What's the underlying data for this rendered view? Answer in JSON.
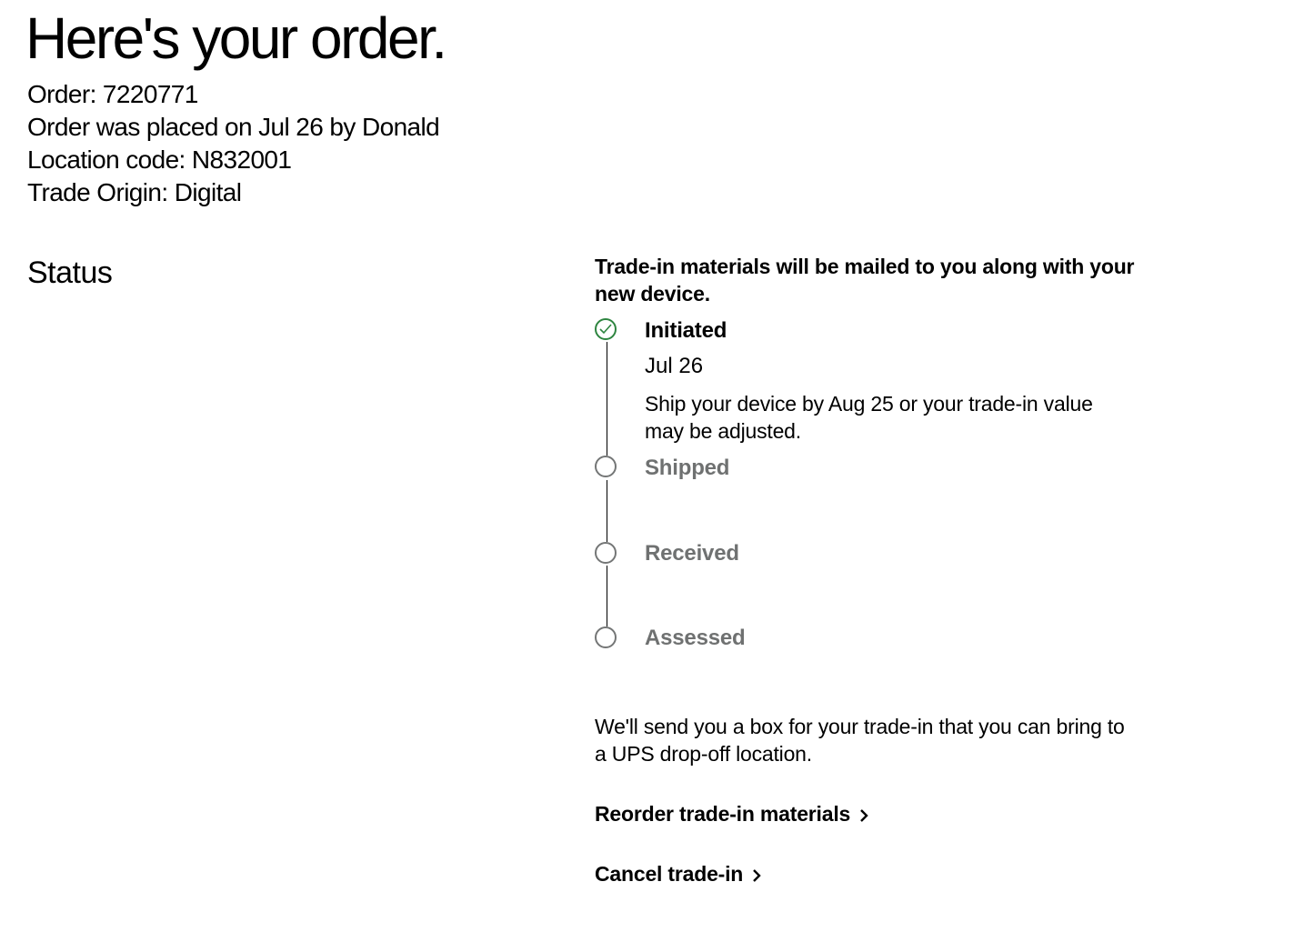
{
  "header": {
    "title": "Here's your order.",
    "order_line": "Order: 7220771",
    "placed_line": "Order was placed on Jul 26 by Donald",
    "location_line": "Location code: N832001",
    "origin_line": "Trade Origin: Digital"
  },
  "status": {
    "heading": "Status",
    "banner": "Trade-in materials will be mailed to you along with your new device.",
    "steps": [
      {
        "label": "Initiated",
        "state": "complete",
        "date": "Jul 26",
        "note": "Ship your device by Aug 25 or your trade-in value may be adjusted."
      },
      {
        "label": "Shipped",
        "state": "pending"
      },
      {
        "label": "Received",
        "state": "pending"
      },
      {
        "label": "Assessed",
        "state": "pending"
      }
    ],
    "info_text": "We'll send you a box for your trade-in that you can bring to a UPS drop-off location."
  },
  "actions": {
    "reorder_label": "Reorder trade-in materials",
    "cancel_label": "Cancel trade-in"
  },
  "colors": {
    "complete": "#2e8540",
    "pending_text": "#6f7171",
    "text": "#000000"
  },
  "icons": {
    "complete_step": "check-circle-icon",
    "pending_step": "empty-circle-icon",
    "link_arrow": "chevron-right-icon"
  }
}
